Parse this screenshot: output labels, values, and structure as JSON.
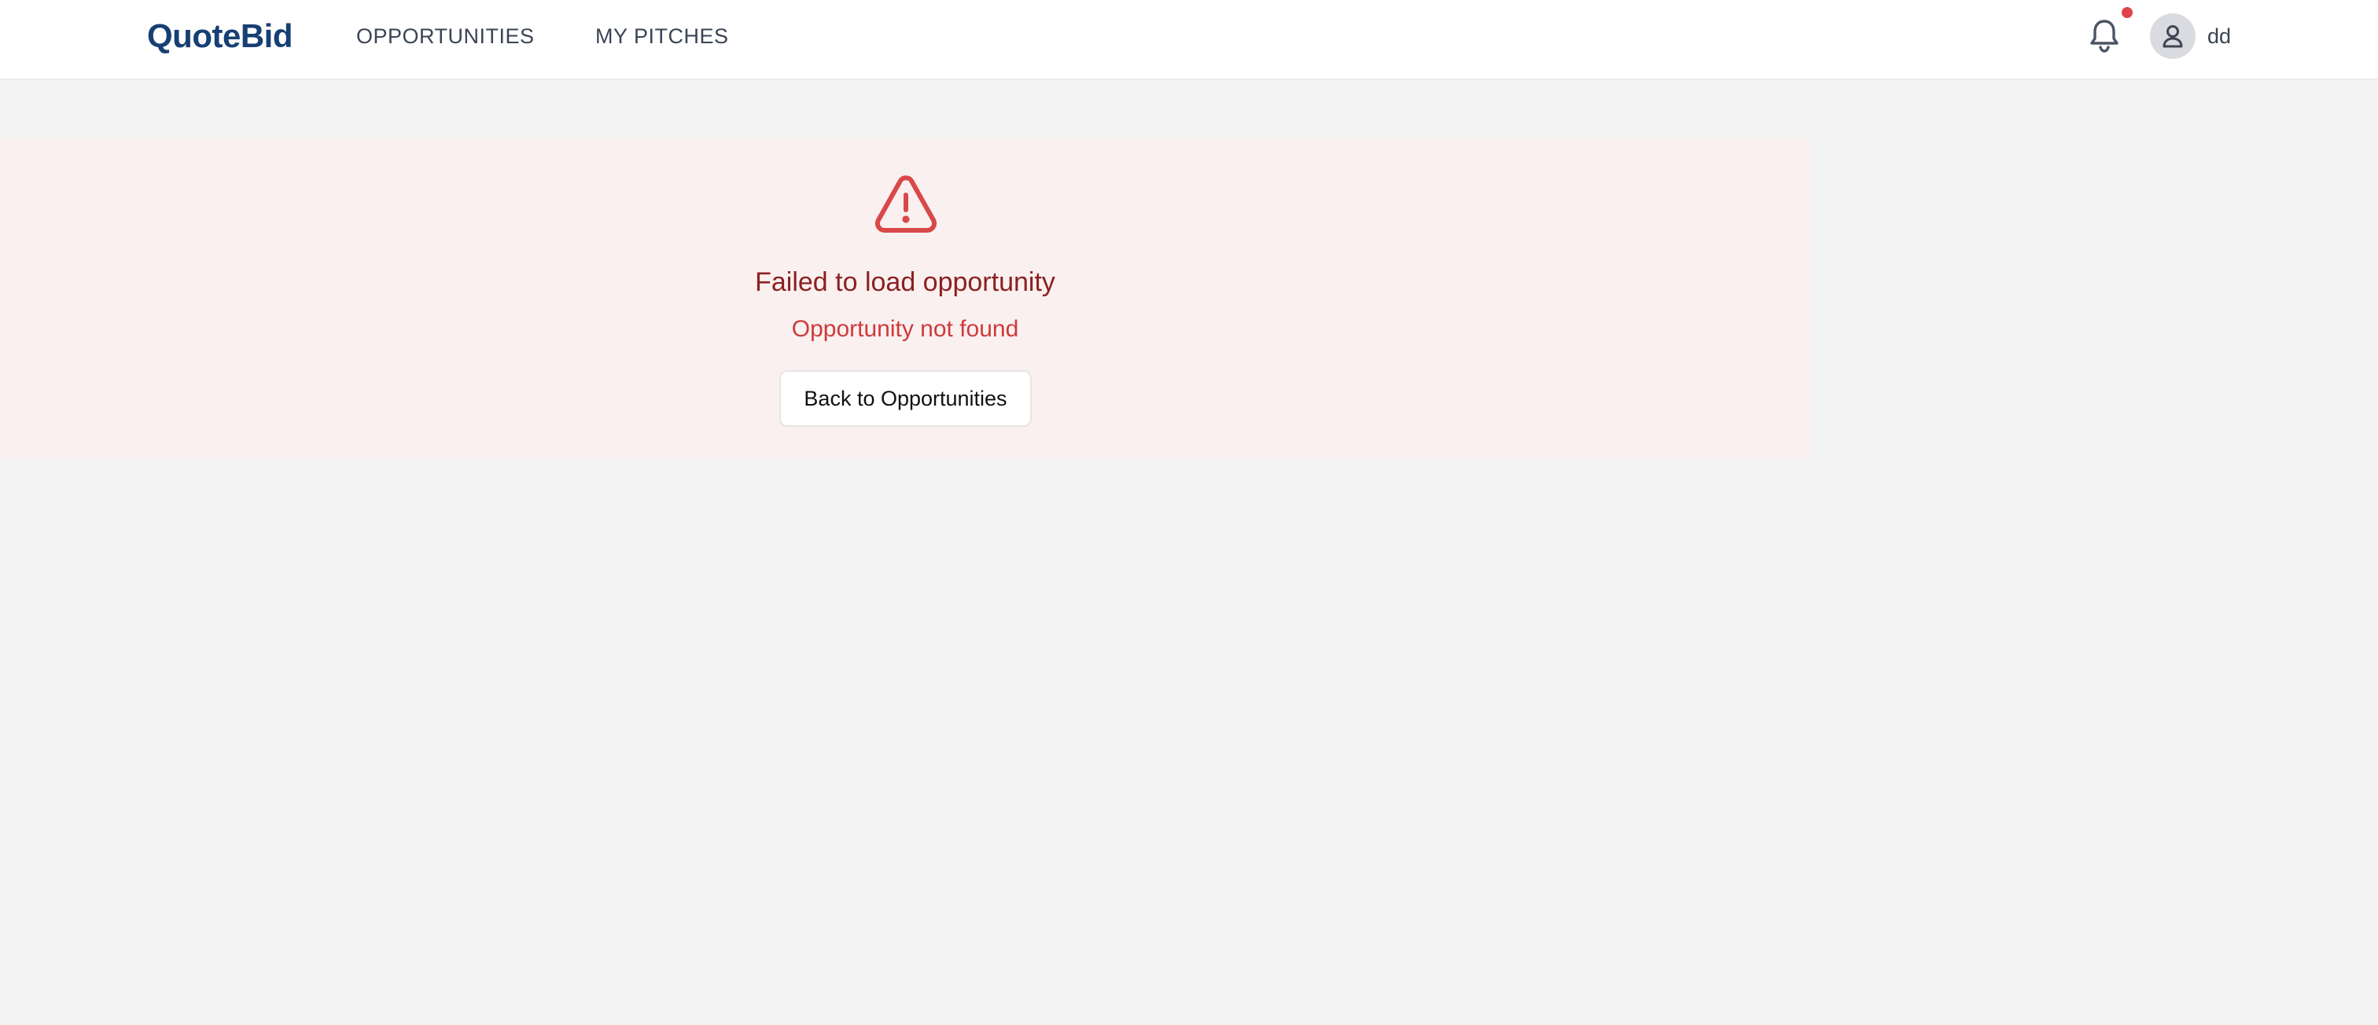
{
  "header": {
    "logo": "QuoteBid",
    "nav": [
      {
        "label": "OPPORTUNITIES"
      },
      {
        "label": "MY PITCHES"
      }
    ],
    "notifications": {
      "icon": "bell-icon",
      "has_unread": true,
      "dot_color": "#e0434a"
    },
    "user": {
      "avatar_icon": "user-icon",
      "name": "dd"
    }
  },
  "error": {
    "icon": "warning-triangle-icon",
    "title": "Failed to load opportunity",
    "message": "Opportunity not found",
    "back_button_label": "Back to Opportunities"
  },
  "colors": {
    "brand": "#173f73",
    "error_title": "#8c2020",
    "error_text": "#cf3a3a",
    "error_panel_bg": "#faf0f0",
    "page_bg": "#f4f4f4"
  }
}
